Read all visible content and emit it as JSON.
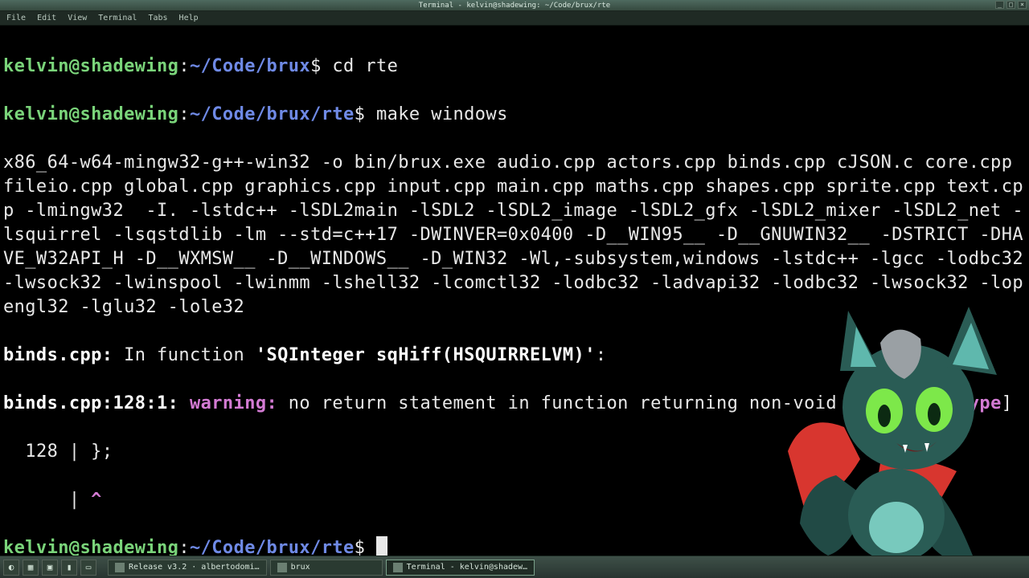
{
  "window": {
    "title": "Terminal - kelvin@shadewing: ~/Code/brux/rte",
    "buttons": {
      "min": "_",
      "max": "□",
      "close": "×"
    }
  },
  "menubar": [
    "File",
    "Edit",
    "View",
    "Terminal",
    "Tabs",
    "Help"
  ],
  "prompt1": {
    "userhost": "kelvin@shadewing",
    "colon": ":",
    "path": "~/Code/brux",
    "dollar": "$ ",
    "cmd": "cd rte"
  },
  "prompt2": {
    "userhost": "kelvin@shadewing",
    "colon": ":",
    "path": "~/Code/brux/rte",
    "dollar": "$ ",
    "cmd": "make windows"
  },
  "compile_output": "x86_64-w64-mingw32-g++-win32 -o bin/brux.exe audio.cpp actors.cpp binds.cpp cJSON.c core.cpp fileio.cpp global.cpp graphics.cpp input.cpp main.cpp maths.cpp shapes.cpp sprite.cpp text.cpp -lmingw32  -I. -lstdc++ -lSDL2main -lSDL2 -lSDL2_image -lSDL2_gfx -lSDL2_mixer -lSDL2_net -lsquirrel -lsqstdlib -lm --std=c++17 -DWINVER=0x0400 -D__WIN95__ -D__GNUWIN32__ -DSTRICT -DHAVE_W32API_H -D__WXMSW__ -D__WINDOWS__ -D_WIN32 -Wl,-subsystem,windows -lstdc++ -lgcc -lodbc32 -lwsock32 -lwinspool -lwinmm -lshell32 -lcomctl32 -lodbc32 -ladvapi32 -lodbc32 -lwsock32 -lopengl32 -lglu32 -lole32",
  "warn_line1": {
    "loc": "binds.cpp:",
    "infunc": " In function ",
    "funcname": "'SQInteger sqHiff(HSQUIRRELVM)'",
    "suffix": ":"
  },
  "warn_line2": {
    "loc": "binds.cpp:128:1: ",
    "warning": "warning: ",
    "msg1": "no return statement in function returning non-void [",
    "flag": "-Wreturn-type",
    "msg2": "]"
  },
  "warn_line3": "  128 | };",
  "warn_line4": "      | ",
  "warn_line4_caret": "^",
  "prompt3": {
    "userhost": "kelvin@shadewing",
    "colon": ":",
    "path": "~/Code/brux/rte",
    "dollar": "$ "
  },
  "taskbar": {
    "task1": "Release v3.2 · albertodomi…",
    "task2": "brux",
    "task3": "Terminal - kelvin@shadew…"
  }
}
